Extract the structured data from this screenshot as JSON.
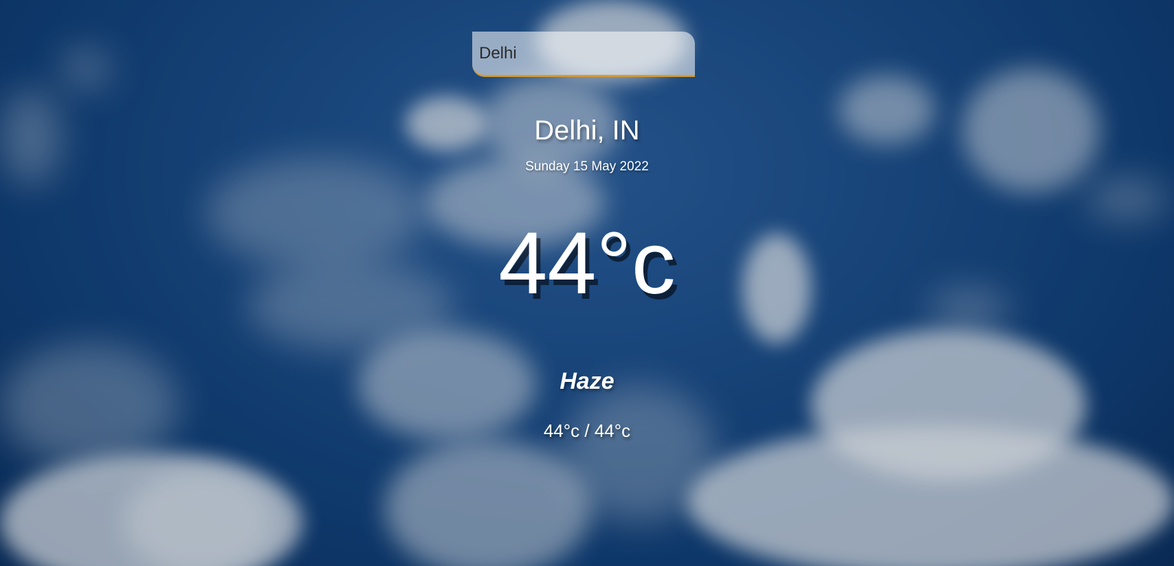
{
  "search": {
    "value": "Delhi"
  },
  "weather": {
    "location": "Delhi, IN",
    "date": "Sunday 15 May 2022",
    "temperature": "44°c",
    "condition": "Haze",
    "hi_lo": "44°c / 44°c"
  },
  "theme": {
    "search_underline_color": "#d99a2b",
    "sky_color": "#1b4f8c"
  }
}
